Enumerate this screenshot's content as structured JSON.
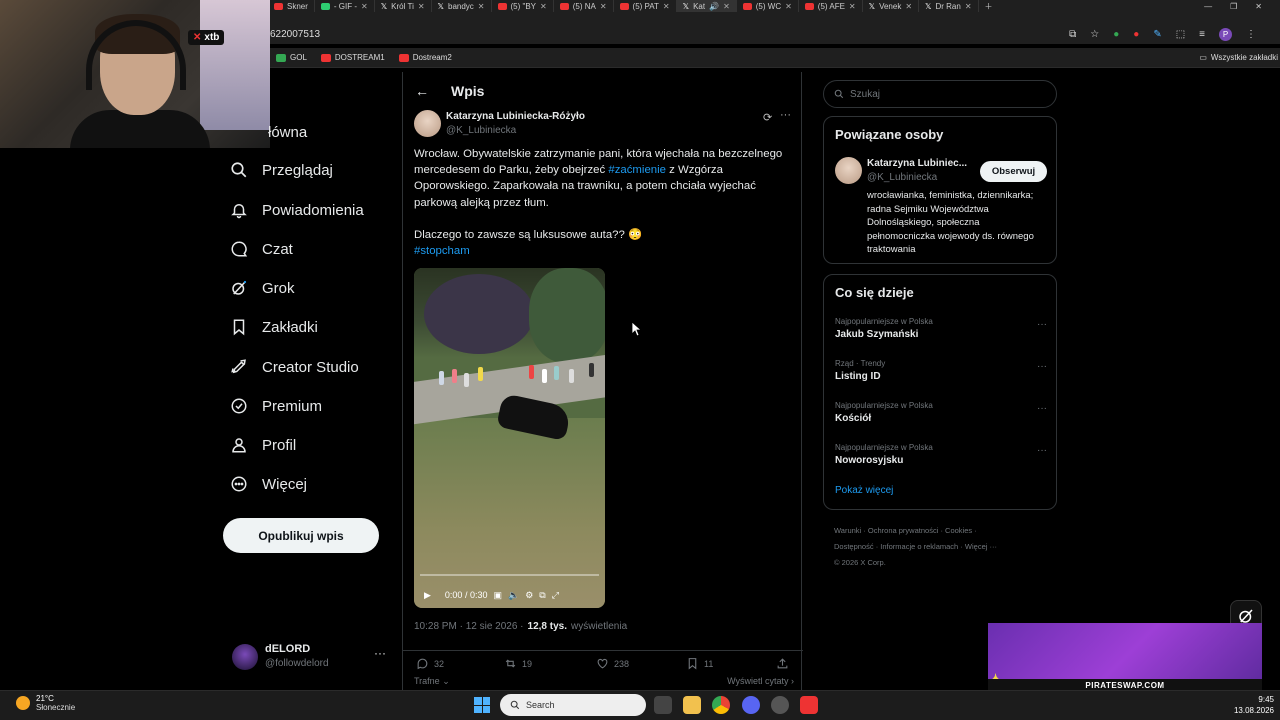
{
  "browser": {
    "tabs": [
      {
        "label": "Skner",
        "icon": "red-app"
      },
      {
        "label": "- GIF -",
        "icon": "green-app"
      },
      {
        "label": "Król Ti",
        "icon": "x-logo"
      },
      {
        "label": "bandyc",
        "icon": "x-logo"
      },
      {
        "label": "(5) \"BY",
        "icon": "youtube"
      },
      {
        "label": "(5) NA",
        "icon": "youtube"
      },
      {
        "label": "(5) PAT",
        "icon": "youtube"
      },
      {
        "label": "Kat",
        "icon": "x-logo",
        "active": true
      },
      {
        "label": "(5) WC",
        "icon": "youtube"
      },
      {
        "label": "(5) AFE",
        "icon": "youtube"
      },
      {
        "label": "Venek",
        "icon": "x-logo"
      },
      {
        "label": "Dr Ran",
        "icon": "x-logo"
      }
    ],
    "address": "622007513",
    "bookmarks": [
      {
        "label": "GOL",
        "color": "#34a853"
      },
      {
        "label": "DOSTREAM1",
        "color": "#e33"
      },
      {
        "label": "Dostream2",
        "color": "#e33"
      }
    ],
    "all_bookmarks": "Wszystkie zakładki"
  },
  "webcam": {
    "badge": "xtb"
  },
  "nav": {
    "items": [
      {
        "label": "łówna",
        "icon": "home-icon"
      },
      {
        "label": "Przeglądaj",
        "icon": "search-icon"
      },
      {
        "label": "Powiadomienia",
        "icon": "bell-icon"
      },
      {
        "label": "Czat",
        "icon": "chat-icon"
      },
      {
        "label": "Grok",
        "icon": "grok-icon"
      },
      {
        "label": "Zakładki",
        "icon": "bookmark-icon"
      },
      {
        "label": "Creator Studio",
        "icon": "rocket-icon"
      },
      {
        "label": "Premium",
        "icon": "verified-icon"
      },
      {
        "label": "Profil",
        "icon": "person-icon"
      },
      {
        "label": "Więcej",
        "icon": "more-circle-icon"
      }
    ],
    "publish": "Opublikuj wpis",
    "account": {
      "name": "dELORD",
      "handle": "@followdelord"
    }
  },
  "post": {
    "header": "Wpis",
    "author": {
      "name": "Katarzyna Lubiniecka-Różyło",
      "handle": "@K_Lubiniecka"
    },
    "text_parts": {
      "p1": "Wrocław. Obywatelskie zatrzymanie pani, która wjechała na bezczelnego mercedesem do Parku, żeby obejrzeć ",
      "tag1": "#zaćmienie",
      "p2": " z Wzgórza Oporowskiego. Zaparkowała na trawniku, a potem chciała wyjechać parkową alejką przez tłum.",
      "p3": "Dlaczego to zawsze są luksusowe auta?? 😳",
      "tag2": "#stopcham"
    },
    "video": {
      "time": "0:00 / 0:30",
      "progress": 0
    },
    "timestamp": "10:28 PM · 12 sie 2026 · ",
    "views": "12,8 tys.",
    "views_label": "wyświetlenia",
    "stats": {
      "replies": "32",
      "reposts": "19",
      "likes": "238",
      "bookmarks": "11"
    },
    "sort": "Trafne",
    "quotes": "Wyświetl cytaty"
  },
  "sidebar": {
    "search_placeholder": "Szukaj",
    "related": {
      "title": "Powiązane osoby",
      "name": "Katarzyna Lubiniec...",
      "handle": "@K_Lubiniecka",
      "follow": "Obserwuj",
      "bio": "wrocławianka, feministka, dziennikarka; radna Sejmiku Województwa Dolnośląskiego, społeczna pełnomocniczka wojewody ds. równego traktowania"
    },
    "trends": {
      "title": "Co się dzieje",
      "items": [
        {
          "meta": "Najpopularniejsze w Polska",
          "name": "Jakub Szymański"
        },
        {
          "meta": "Rząd · Trendy",
          "name": "Listing ID"
        },
        {
          "meta": "Najpopularniejsze w Polska",
          "name": "Kościół"
        },
        {
          "meta": "Najpopularniejsze w Polska",
          "name": "Noworosyjsku"
        }
      ],
      "show_more": "Pokaż więcej"
    },
    "footer": {
      "l1": "Warunki",
      "l2": "Ochrona prywatności",
      "l3": "Cookies",
      "l4": "Dostępność",
      "l5": "Informacje o reklamach",
      "l6": "Więcej ···",
      "copyright": "© 2026 X Corp."
    }
  },
  "overlay": {
    "pip_banner": "PIRATESWAP.COM"
  },
  "taskbar": {
    "temp": "21°C",
    "weather": "Słonecznie",
    "search": "Search",
    "time": "9:45",
    "date": "13.08.2026"
  }
}
